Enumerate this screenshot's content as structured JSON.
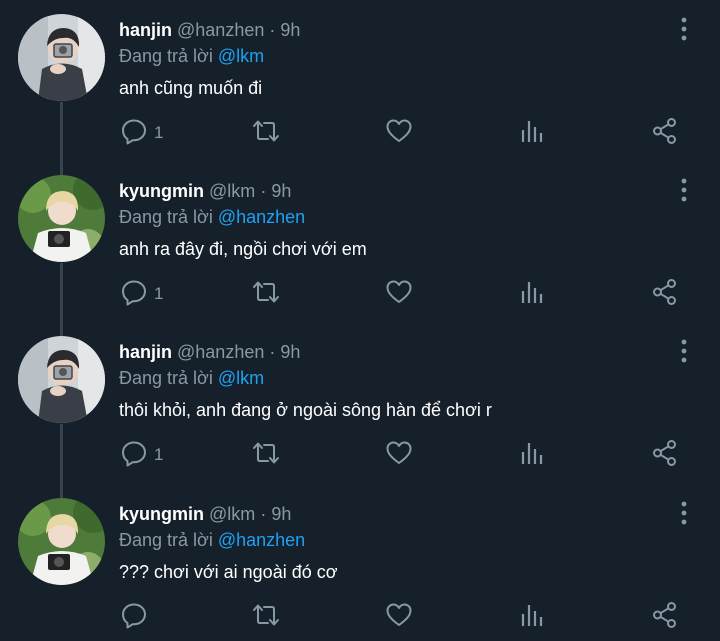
{
  "replying_prefix": "Đang trả lời",
  "icons": {
    "more": "more-vertical-icon",
    "reply": "reply-icon",
    "retweet": "retweet-icon",
    "like": "like-icon",
    "analytics": "analytics-icon",
    "share": "share-icon"
  },
  "colors": {
    "background": "#15202b",
    "secondary_text": "#8899a6",
    "mention": "#1da1f2",
    "thread_line": "#38444d"
  },
  "tweets": [
    {
      "name": "hanjin",
      "handle": "@hanzhen",
      "time": "9h",
      "replying_to": "@lkm",
      "text": "anh cũng muốn đi",
      "reply_count": "1"
    },
    {
      "name": "kyungmin",
      "handle": "@lkm",
      "time": "9h",
      "replying_to": "@hanzhen",
      "text": "anh ra đây đi, ngồi chơi với em",
      "reply_count": "1"
    },
    {
      "name": "hanjin",
      "handle": "@hanzhen",
      "time": "9h",
      "replying_to": "@lkm",
      "text": "thôi khỏi, anh đang ở ngoài sông hàn để chơi r",
      "reply_count": "1"
    },
    {
      "name": "kyungmin",
      "handle": "@lkm",
      "time": "9h",
      "replying_to": "@hanzhen",
      "text": "??? chơi với ai ngoài đó cơ",
      "reply_count": ""
    }
  ]
}
